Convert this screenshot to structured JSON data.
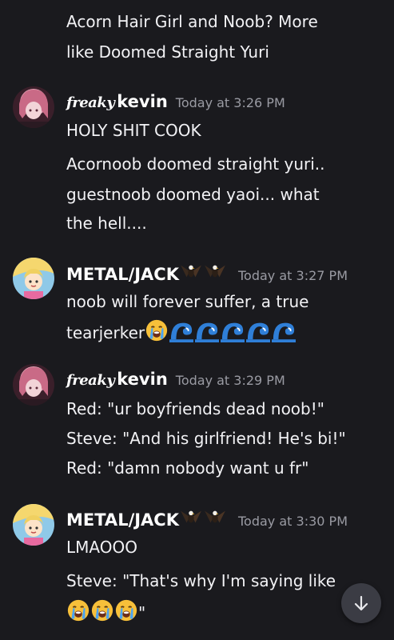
{
  "messages": {
    "m0": {
      "lines": [
        "Acorn Hair Girl and Noob? More",
        "like Doomed Straight Yuri"
      ]
    },
    "m1": {
      "username_prefix": "freaky",
      "username": "kevin",
      "timestamp": "Today at 3:26 PM",
      "lines": [
        "HOLY SHIT COOK",
        "Acornoob doomed straight yuri..",
        "guestnoob doomed yaoi... what",
        "the hell...."
      ]
    },
    "m2": {
      "username": "METAL/JACK",
      "timestamp": "Today at 3:27 PM",
      "lines": [
        "noob will forever suffer, a true",
        "tearjerker"
      ]
    },
    "m3": {
      "username_prefix": "freaky",
      "username": "kevin",
      "timestamp": "Today at 3:29 PM",
      "lines": [
        "Red: \"ur boyfriends dead noob!\"",
        "Steve: \"And his girlfriend! He's bi!\"",
        "Red: \"damn nobody want u fr\""
      ]
    },
    "m4": {
      "username": "METAL/JACK",
      "timestamp": "Today at 3:30 PM",
      "lines": [
        "LMAOOO",
        "Steve: \"That's why I'm saying like",
        "\""
      ]
    }
  },
  "icons": {
    "crying_emoji": "loudly-crying-face",
    "wave_emoji": "water-wave",
    "eagle_emoji": "eagle",
    "scroll_down": "arrow-down-icon"
  },
  "colors": {
    "background": "#1a1a1e",
    "text": "#f2f2f5",
    "timestamp": "#9a9ba3",
    "scroll_button": "#3b3c44"
  }
}
